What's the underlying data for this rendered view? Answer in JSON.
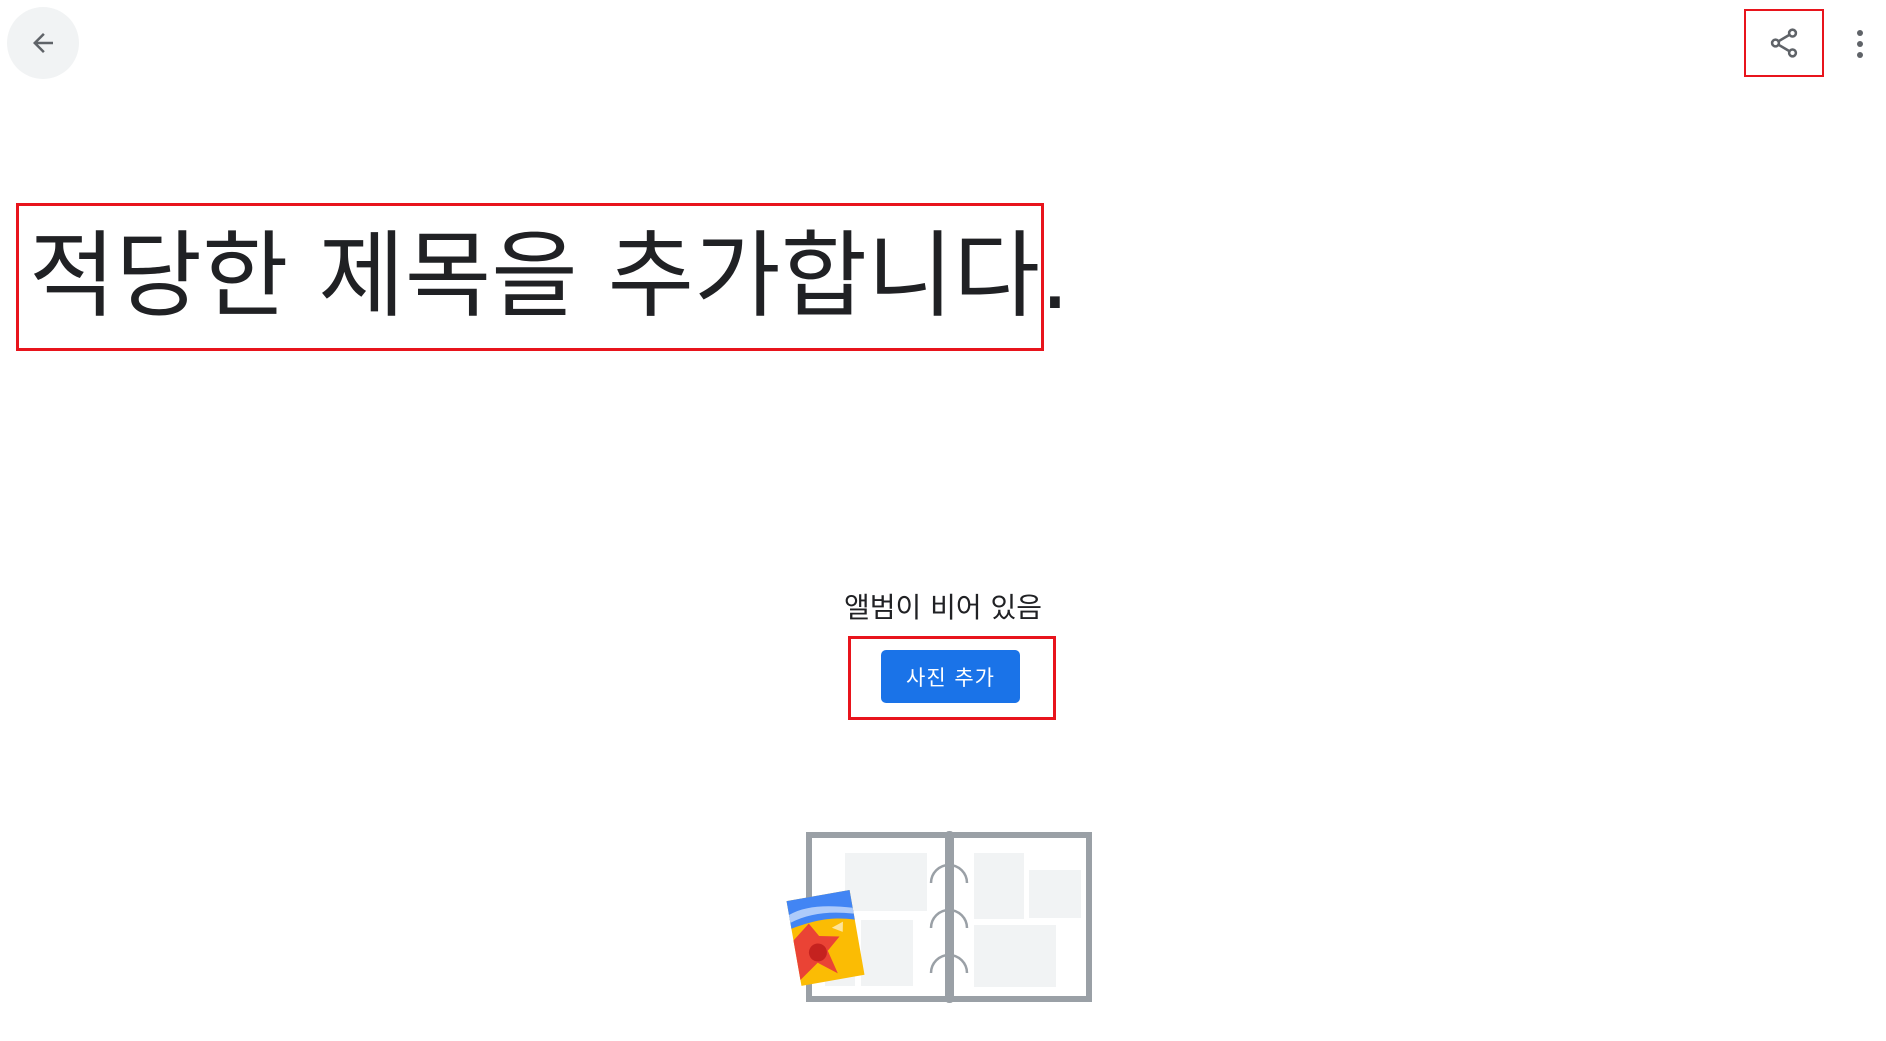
{
  "header": {
    "back_icon": "arrow-left-icon",
    "share_icon": "share-icon",
    "more_icon": "more-vertical-icon"
  },
  "album": {
    "title": "적당한 제목을 추가합니다."
  },
  "empty_state": {
    "message": "앨범이 비어 있음",
    "add_photos_label": "사진 추가",
    "illustration_icon": "photo-album-illustration"
  },
  "colors": {
    "accent": "#1a73e8",
    "highlight_border": "#e8141c",
    "back_button_bg": "#f1f3f4",
    "text": "#202124",
    "icon": "#5f6368"
  }
}
